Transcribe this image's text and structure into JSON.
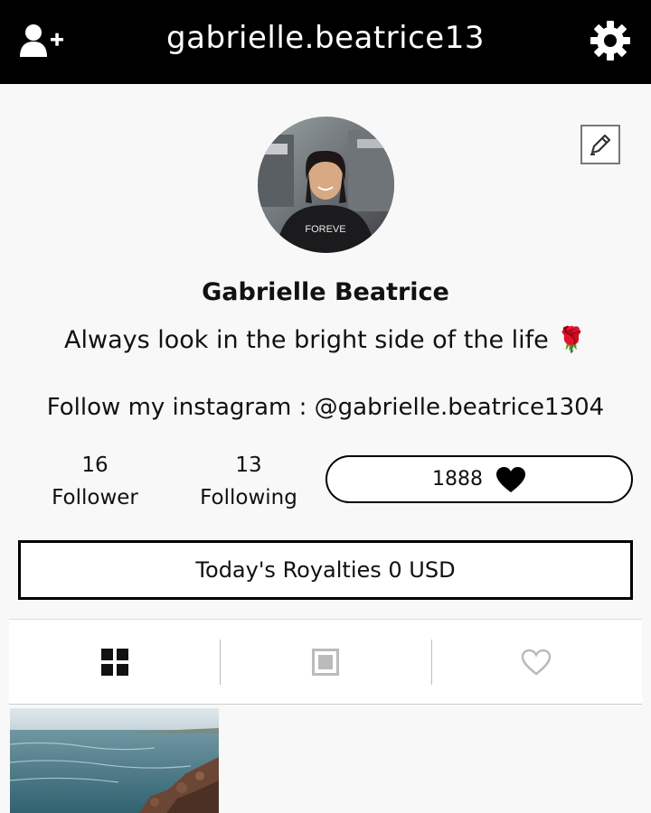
{
  "header": {
    "username": "gabrielle.beatrice13",
    "add_user_icon": "add-user-icon",
    "settings_icon": "gear-icon"
  },
  "profile": {
    "edit_icon": "pencil-icon",
    "display_name": "Gabrielle Beatrice",
    "bio_line1": "Always look in the bright side of the life 🌹",
    "bio_line2": "Follow my instagram : @gabrielle.beatrice1304"
  },
  "stats": {
    "followers_count": "16",
    "followers_label": "Follower",
    "following_count": "13",
    "following_label": "Following",
    "likes_count": "1888"
  },
  "royalties": {
    "label": "Today's Royalties 0 USD"
  },
  "tabs": [
    {
      "icon": "grid-icon",
      "active": true
    },
    {
      "icon": "square-icon",
      "active": false
    },
    {
      "icon": "heart-icon",
      "active": false
    }
  ],
  "colors": {
    "header_bg": "#000000",
    "active_tab": "#111111",
    "inactive_tab": "#bbbbbb"
  }
}
